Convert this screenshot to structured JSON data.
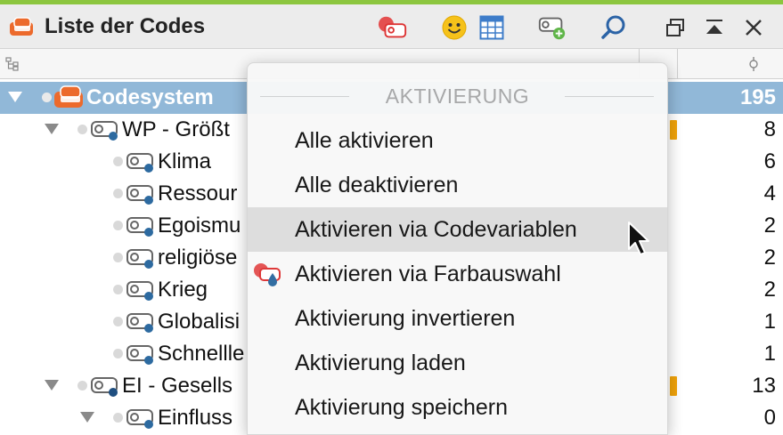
{
  "window": {
    "title": "Liste der Codes"
  },
  "toolbar": {
    "buttons": [
      {
        "name": "color-code-icon"
      },
      {
        "name": "emoticon-icon"
      },
      {
        "name": "table-icon"
      },
      {
        "name": "new-code-icon"
      },
      {
        "name": "search-icon"
      },
      {
        "name": "undock-window-icon"
      },
      {
        "name": "collapse-window-icon"
      },
      {
        "name": "close-icon"
      }
    ]
  },
  "tree": {
    "rows": [
      {
        "label": "Codesystem",
        "count": "195",
        "selected": true
      },
      {
        "label": "WP - Größte Weltprobleme",
        "visible_label": "WP - Größt",
        "count": "8",
        "marker": true
      },
      {
        "label": "Klima",
        "count": "6"
      },
      {
        "label": "Ressourcen",
        "visible_label": "Ressour",
        "count": "4"
      },
      {
        "label": "Egoismus",
        "visible_label": "Egoismu",
        "count": "2"
      },
      {
        "label": "religiöse",
        "visible_label": "religiöse",
        "count": "2"
      },
      {
        "label": "Krieg",
        "count": "2"
      },
      {
        "label": "Globalisierung",
        "visible_label": "Globalisi",
        "count": "1"
      },
      {
        "label": "Schnelllebigkeit",
        "visible_label": "Schnellle",
        "count": "1"
      },
      {
        "label": "EI - Gesellschaftliche Einflussnahme",
        "visible_label": "EI - Gesells",
        "count": "13",
        "marker": true
      },
      {
        "label": "Einfluss möglich",
        "visible_label": "Einfluss",
        "count": "0"
      }
    ]
  },
  "menu": {
    "header": "AKTIVIERUNG",
    "items": [
      {
        "label": "Alle aktivieren"
      },
      {
        "label": "Alle deaktivieren"
      },
      {
        "label": "Aktivieren via Codevariablen",
        "hover": true
      },
      {
        "label": "Aktivieren via Farbauswahl",
        "icon": "color-activation-icon"
      },
      {
        "label": "Aktivierung invertieren"
      },
      {
        "label": "Aktivierung laden"
      },
      {
        "label": "Aktivierung speichern"
      }
    ]
  },
  "colors": {
    "accent_top": "#8cc63f",
    "selection": "#91b8d8",
    "code_dot": "#2d6aa0",
    "marker": "#f0a30a",
    "app_icon": "#ec6a2c"
  }
}
